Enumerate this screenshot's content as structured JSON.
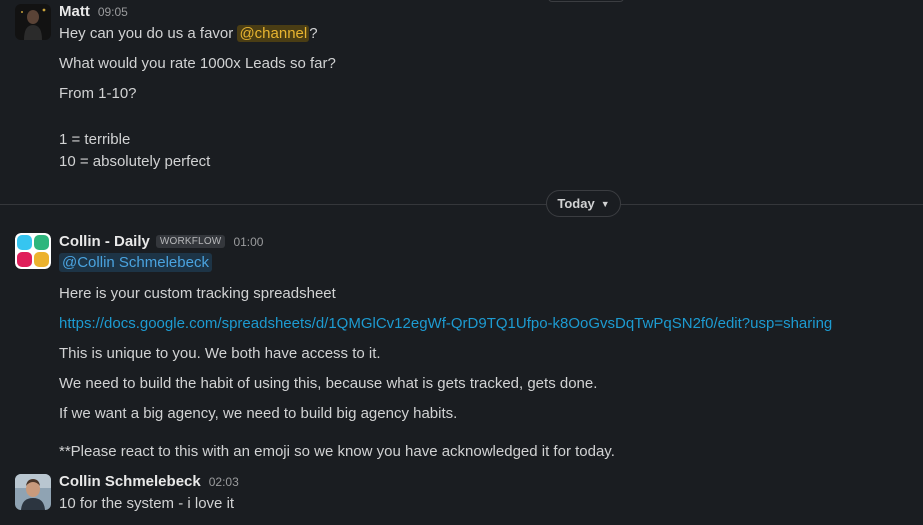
{
  "messages": [
    {
      "sender": "Matt",
      "time": "09:05",
      "line1_prefix": "Hey can you do us a favor ",
      "line1_mention": "@channel",
      "line1_suffix": "?",
      "line2": "What would you rate 1000x Leads so far?",
      "line3": "From 1-10?",
      "line4": "1 = terrible",
      "line5": "10 = absolutely perfect"
    },
    {
      "sender": "Collin - Daily",
      "badge": "WORKFLOW",
      "time": "01:00",
      "mention": "@Collin Schmelebeck",
      "line1": "Here is your custom tracking spreadsheet",
      "link": "https://docs.google.com/spreadsheets/d/1QMGlCv12egWf-QrD9TQ1Ufpo-k8OoGvsDqTwPqSN2f0/edit?usp=sharing",
      "line2": "This is unique to you. We both have access to it.",
      "line3": "We need to build the habit of using this, because what is gets tracked, gets done.",
      "line4": "If we want a big agency, we need to build big agency habits.",
      "line5": "**Please react to this with an emoji so we know you have acknowledged it for today."
    },
    {
      "sender": "Collin Schmelebeck",
      "time": "02:03",
      "line1": "10 for the system - i love it"
    }
  ],
  "divider": {
    "label": "Today",
    "icon": "chevron-down-icon"
  },
  "colors": {
    "background": "#1a1d21",
    "link": "#1d9bd1",
    "channel_mention": "#e8b430",
    "user_mention": "#4aa3df"
  }
}
